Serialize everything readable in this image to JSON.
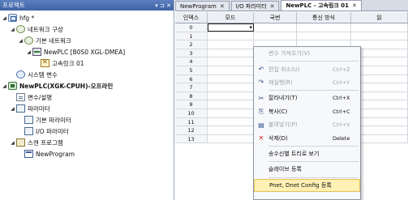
{
  "project_panel": {
    "title": "프로젝트",
    "pin": "▾ ⊐ ✕",
    "tree": [
      {
        "label": "hfg *"
      },
      {
        "label": "네트워크 구성"
      },
      {
        "label": "기본 네트워크"
      },
      {
        "label": "NewPLC [B0S0 XGL-DMEA]"
      },
      {
        "label": "고속링크 01"
      },
      {
        "label": "시스템 변수"
      },
      {
        "label": "NewPLC(XGK-CPUH)-오프라인"
      },
      {
        "label": "변수/설명"
      },
      {
        "label": "파라미터"
      },
      {
        "label": "기본 파라미터"
      },
      {
        "label": "I/O 파라미터"
      },
      {
        "label": "스캔 프로그램"
      },
      {
        "label": "NewProgram"
      }
    ]
  },
  "tabs": [
    {
      "label": "NewProgram"
    },
    {
      "label": "I/O 파라미터"
    },
    {
      "label": "NewPLC - 고속링크 01"
    }
  ],
  "close_glyph": "✕",
  "grid": {
    "headers": [
      "인덱스",
      "모드",
      "국번",
      "통신 방식",
      "읽"
    ],
    "rows": [
      "0",
      "1",
      "2",
      "3",
      "4",
      "5",
      "6",
      "7",
      "8",
      "9",
      "10",
      "11",
      "12",
      "13"
    ]
  },
  "context_menu": {
    "items": [
      {
        "icon": "",
        "label": "변수 가져오기(V)",
        "shortcut": ""
      },
      {
        "icon": "↶",
        "label": "편집 취소(U)",
        "shortcut": "Ctrl+Z"
      },
      {
        "icon": "↷",
        "label": "재실행(R)",
        "shortcut": "Ctrl+Y"
      },
      {
        "icon": "✂",
        "label": "잘라내기(T)",
        "shortcut": "Ctrl+X"
      },
      {
        "icon": "⎘",
        "label": "복사(C)",
        "shortcut": "Ctrl+C"
      },
      {
        "icon": "▤",
        "label": "붙여넣기(P)",
        "shortcut": "Ctrl+V"
      },
      {
        "icon": "✕",
        "label": "삭제(D)",
        "shortcut": "Delete"
      },
      {
        "icon": "",
        "label": "송수신별 트리로 보기",
        "shortcut": ""
      },
      {
        "icon": "",
        "label": "슬레이브 등록",
        "shortcut": ""
      },
      {
        "icon": "",
        "label": "Pnet, Dnet Config 등록",
        "shortcut": ""
      }
    ]
  }
}
